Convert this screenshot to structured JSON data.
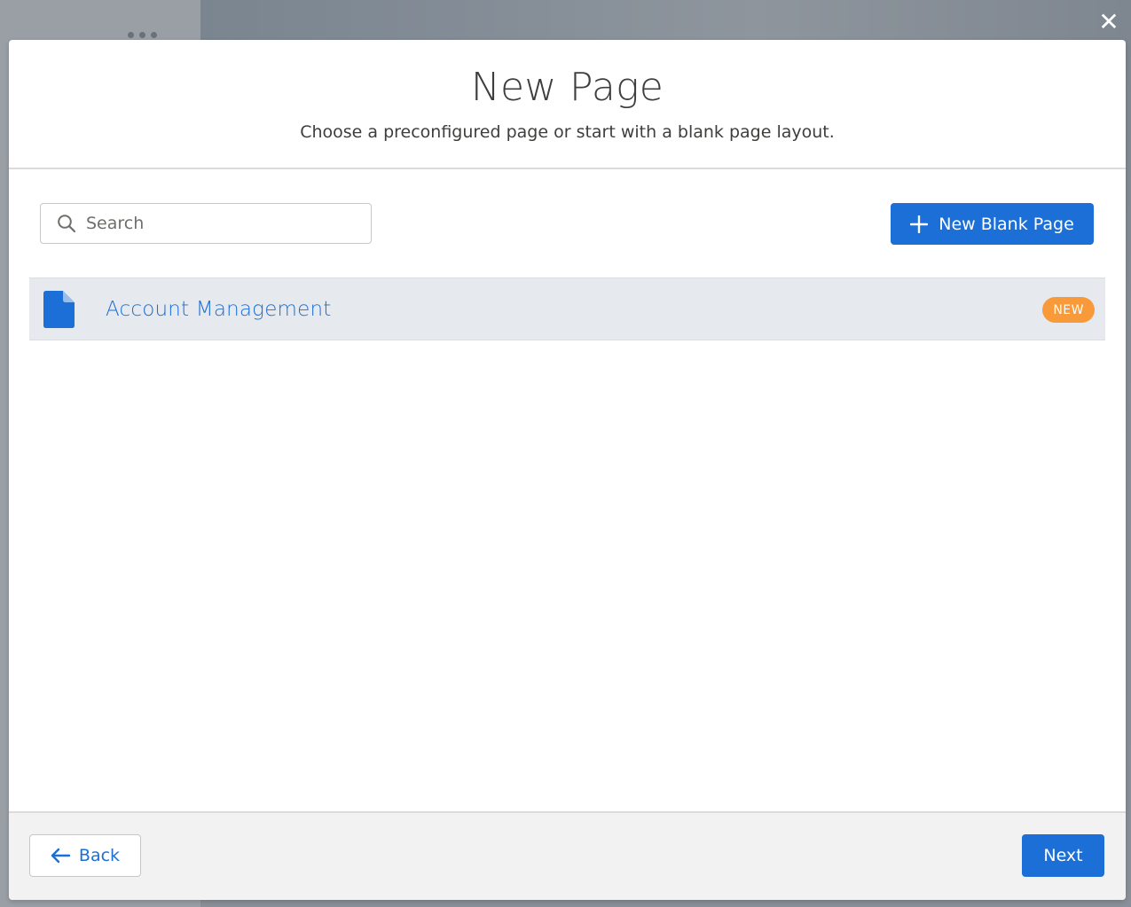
{
  "header": {
    "title": "New Page",
    "subtitle": "Choose a preconfigured page or start with a blank page layout."
  },
  "close": {
    "icon": "close-icon",
    "glyph": "✕"
  },
  "search": {
    "placeholder": "Search",
    "value": ""
  },
  "actions": {
    "new_blank_label": "New Blank Page"
  },
  "templates": [
    {
      "label": "Account Management",
      "badge": "NEW",
      "icon": "document-icon"
    }
  ],
  "footer": {
    "back_label": "Back",
    "next_label": "Next"
  },
  "colors": {
    "brand": "#1b6fd6",
    "badge": "#f89a3a",
    "selected_row": "#e6e9ee"
  }
}
